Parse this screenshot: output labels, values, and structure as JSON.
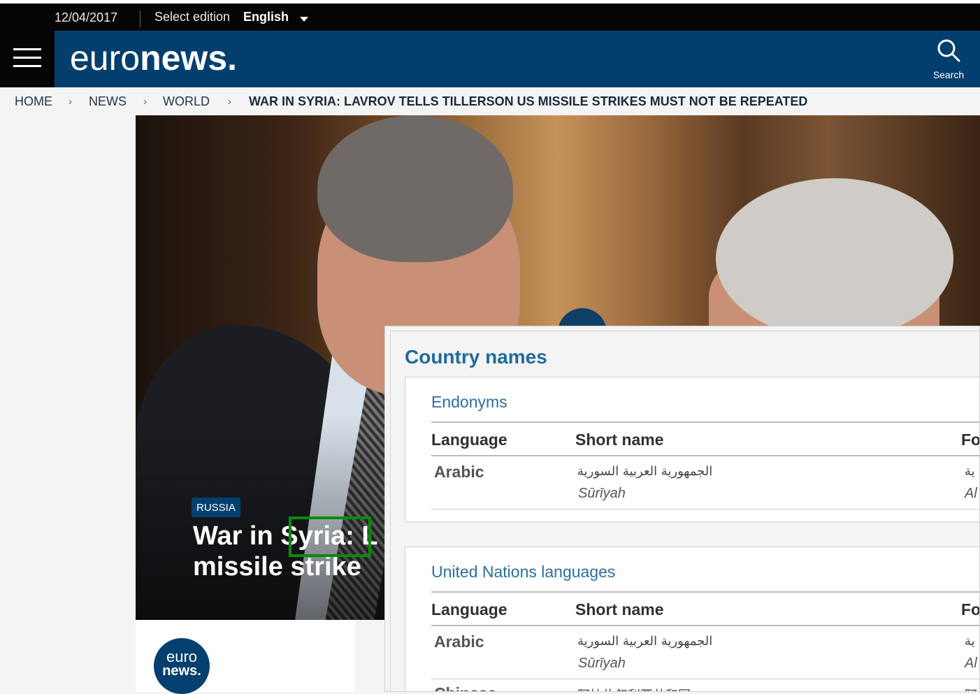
{
  "topbar": {
    "date": "12/04/2017",
    "edition_label": "Select edition",
    "edition_value": "English"
  },
  "header": {
    "logo_light": "euro",
    "logo_bold": "news.",
    "search_label": "Search"
  },
  "breadcrumb": {
    "items": [
      "HOME",
      "NEWS",
      "WORLD"
    ],
    "separator": "›",
    "current": "WAR IN SYRIA: LAVROV TELLS TILLERSON US MISSILE STRIKES MUST NOT BE REPEATED"
  },
  "article": {
    "tag": "RUSSIA",
    "title_line1": "War in Syria: L",
    "title_line2": "missile strike"
  },
  "card": {
    "logo_line1": "euro",
    "logo_line2": "news."
  },
  "popup": {
    "title": "Country names",
    "sections": [
      {
        "title": "Endonyms",
        "headers": [
          "Language",
          "Short name",
          "Fo"
        ],
        "rows": [
          {
            "language": "Arabic",
            "short_name": "الجمهورية العربية السورية",
            "short_translit": "Sūrīyah",
            "formal_partial": "ية",
            "formal_translit_partial": "Al"
          }
        ]
      },
      {
        "title": "United Nations languages",
        "headers": [
          "Language",
          "Short name",
          "Fo"
        ],
        "rows": [
          {
            "language": "Arabic",
            "short_name": "الجمهورية العربية السورية",
            "short_translit": "Sūrīyah",
            "formal_partial": "ية",
            "formal_translit_partial": "Al"
          },
          {
            "language": "Chinese",
            "short_name": "阿拉伯叙利亚共和国",
            "short_translit": "",
            "formal_partial": "阿",
            "formal_translit_partial": ""
          }
        ]
      }
    ]
  },
  "colors": {
    "header_blue": "#033f6e",
    "popup_title": "#1f6aa0",
    "highlight_green": "#0a8a0a"
  }
}
